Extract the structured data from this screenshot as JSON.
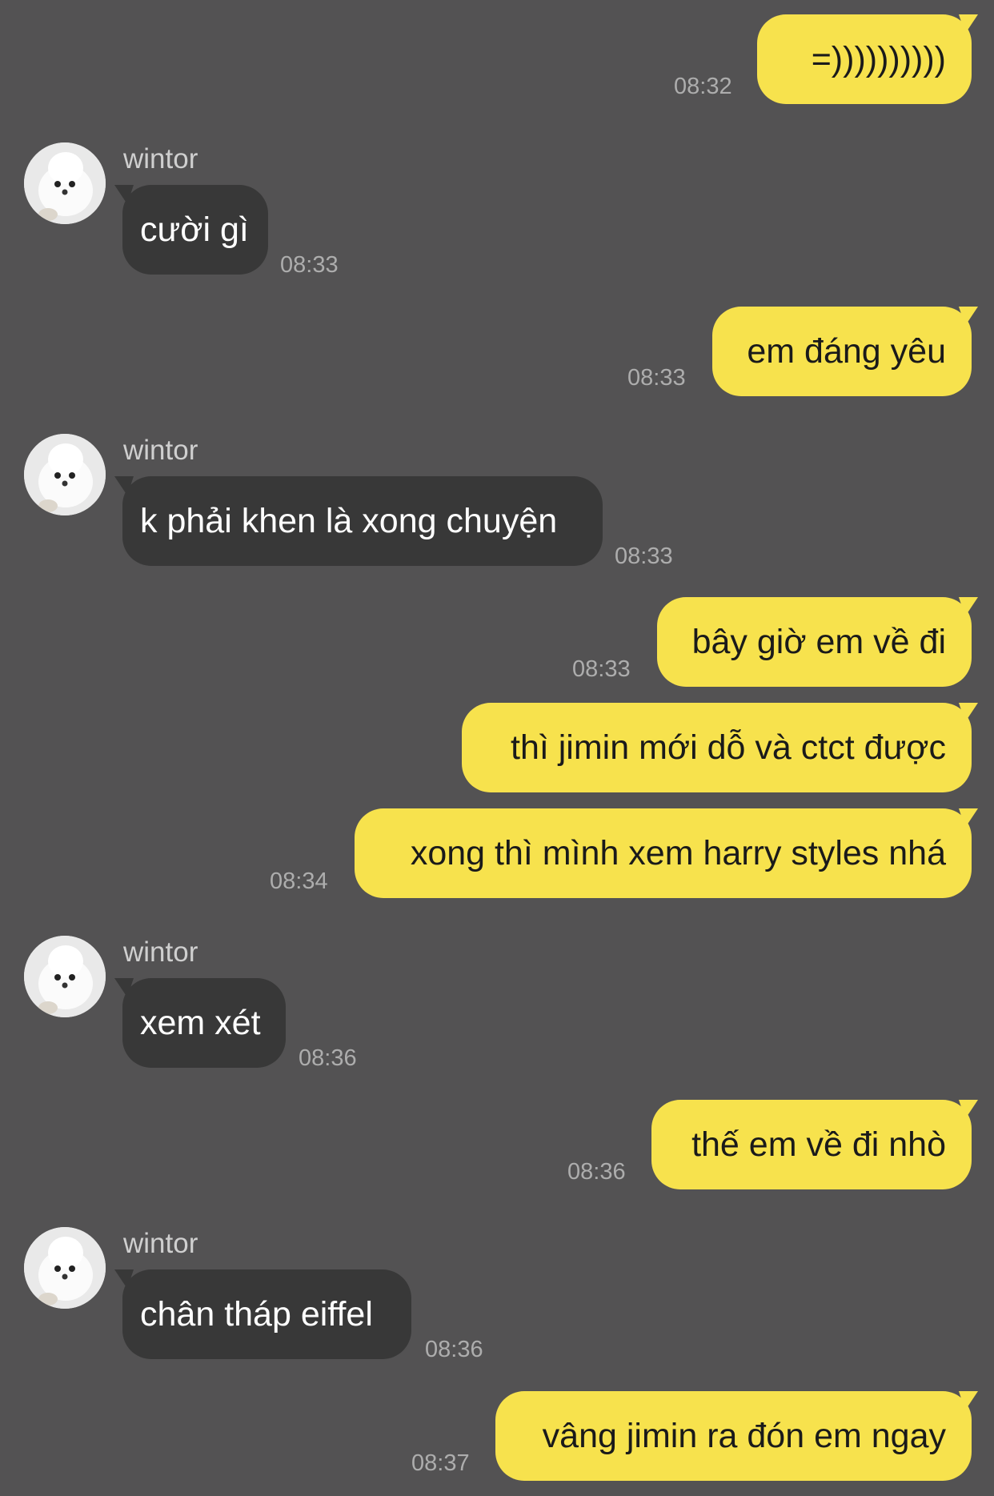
{
  "messages": [
    {
      "dir": "out",
      "text": "=))))))))))",
      "time": "08:32"
    },
    {
      "dir": "in",
      "sender": "wintor",
      "text": "cười gì",
      "time": "08:33"
    },
    {
      "dir": "out",
      "text": "em đáng yêu",
      "time": "08:33"
    },
    {
      "dir": "in",
      "sender": "wintor",
      "text": "k phải khen là xong chuyện",
      "time": "08:33"
    },
    {
      "dir": "out",
      "text": "bây giờ em về đi",
      "time": "08:33"
    },
    {
      "dir": "out",
      "text": "thì jimin mới dỗ và ctct được",
      "time": ""
    },
    {
      "dir": "out",
      "text": "xong thì mình xem harry styles nhá",
      "time": "08:34"
    },
    {
      "dir": "in",
      "sender": "wintor",
      "text": "xem xét",
      "time": "08:36"
    },
    {
      "dir": "out",
      "text": "thế em về đi nhò",
      "time": "08:36"
    },
    {
      "dir": "in",
      "sender": "wintor",
      "text": "chân tháp eiffel",
      "time": "08:36"
    },
    {
      "dir": "out",
      "text": "vâng jimin ra đón em ngay",
      "time": "08:37"
    }
  ],
  "colors": {
    "background": "#535253",
    "outgoing_bubble": "#f7e24d",
    "incoming_bubble": "#383838"
  },
  "icons": {
    "avatar": "white-dog-avatar-icon"
  }
}
